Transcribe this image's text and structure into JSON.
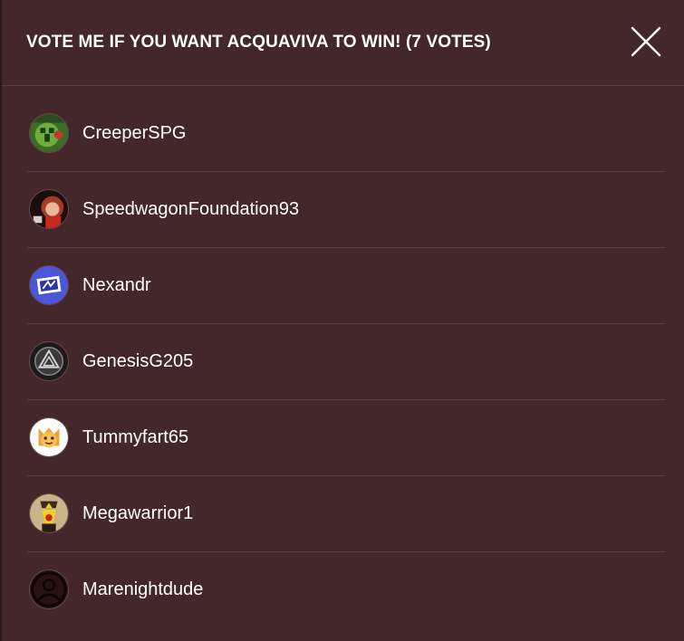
{
  "modal": {
    "title": "VOTE ME IF YOU WANT ACQUAVIVA TO WIN! (7 VOTES)",
    "close_icon": "close-icon"
  },
  "voters": [
    {
      "username": "CreeperSPG",
      "avatar": "avatar-creeper"
    },
    {
      "username": "SpeedwagonFoundation93",
      "avatar": "avatar-speedwagon"
    },
    {
      "username": "Nexandr",
      "avatar": "avatar-nexandr"
    },
    {
      "username": "GenesisG205",
      "avatar": "avatar-genesis"
    },
    {
      "username": "Tummyfart65",
      "avatar": "avatar-tummyfart"
    },
    {
      "username": "Megawarrior1",
      "avatar": "avatar-megawarrior"
    },
    {
      "username": "Marenightdude",
      "avatar": "avatar-default"
    }
  ],
  "colors": {
    "modal_background": "#43272a",
    "divider": "#5a3c3f",
    "text": "#ffffff"
  }
}
